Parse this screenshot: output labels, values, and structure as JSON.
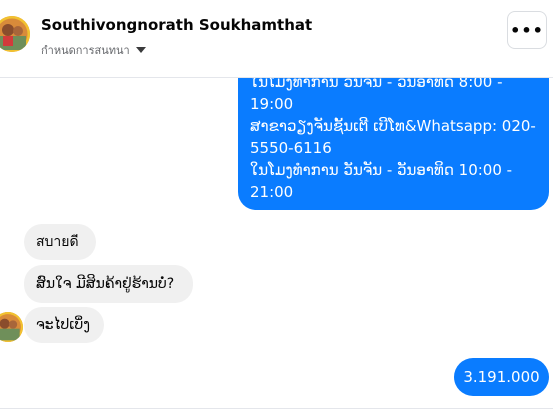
{
  "header": {
    "contact_name": "Southivongnorath Soukhamthat",
    "conversation_settings_label": "กำหนดการสนทนา"
  },
  "messages": {
    "sent_info_lines": [
      "ໃນໂມງທຳການ ວັນຈັນ - ວັນອາທິດ 8:00 -",
      "19:00",
      "ສາຂາວຽງຈັນຊັ້ນເຕີ ເບີໂທ&Whatsapp: 020-",
      "5550-6116",
      "ໃນໂມງທຳການ ວັນຈັນ - ວັນອາທິດ  10:00 -",
      "21:00"
    ],
    "received": [
      "สบายดี",
      "ສົນໃຈ ມີສິນຄ້າຢູ່ຮ້ານບໍ່?",
      "ຈະໄປເບິ່ງ"
    ],
    "sent_price": "3.191.000"
  },
  "colors": {
    "sent_bubble": "#0a7cff",
    "received_bubble": "#f0f0f0"
  }
}
